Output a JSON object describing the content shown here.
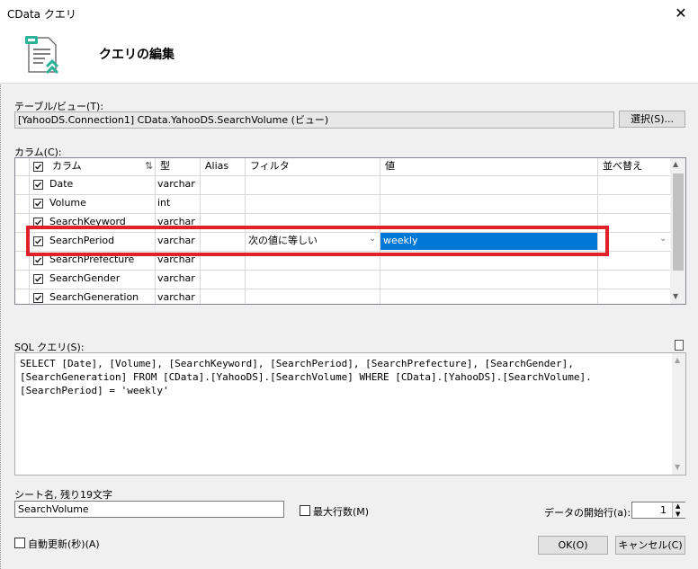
{
  "window": {
    "title": "CData クエリ",
    "close_glyph": "✕"
  },
  "header": {
    "title": "クエリの編集",
    "icon": "query-document-icon"
  },
  "table_view": {
    "label": "テーブル/ビュー(T):",
    "value": "[YahooDS.Connection1] CData.YahooDS.SearchVolume (ビュー)",
    "select_button": "選択(S)..."
  },
  "columns": {
    "label": "カラム(C):",
    "headers": {
      "column": "カラム",
      "type": "型",
      "alias": "Alias",
      "filter": "フィルタ",
      "value": "値",
      "sort": "並べ替え"
    },
    "rows": [
      {
        "checked": true,
        "name": "Date",
        "type": "varchar",
        "alias": "",
        "filter": "",
        "value": ""
      },
      {
        "checked": true,
        "name": "Volume",
        "type": "int",
        "alias": "",
        "filter": "",
        "value": ""
      },
      {
        "checked": true,
        "name": "SearchKeyword",
        "type": "varchar",
        "alias": "",
        "filter": "",
        "value": ""
      },
      {
        "checked": true,
        "name": "SearchPeriod",
        "type": "varchar",
        "alias": "",
        "filter": "次の値に等しい",
        "value": "weekly"
      },
      {
        "checked": true,
        "name": "SearchPrefecture",
        "type": "varchar",
        "alias": "",
        "filter": "",
        "value": ""
      },
      {
        "checked": true,
        "name": "SearchGender",
        "type": "varchar",
        "alias": "",
        "filter": "",
        "value": ""
      },
      {
        "checked": true,
        "name": "SearchGeneration",
        "type": "varchar",
        "alias": "",
        "filter": "",
        "value": ""
      }
    ]
  },
  "sql": {
    "label": "SQL クエリ(S):",
    "text": "SELECT [Date], [Volume], [SearchKeyword], [SearchPeriod], [SearchPrefecture], [SearchGender],\n[SearchGeneration] FROM [CData].[YahooDS].[SearchVolume] WHERE [CData].[YahooDS].[SearchVolume].\n[SearchPeriod] = 'weekly'"
  },
  "sheet": {
    "label": "シート名, 残り19文字",
    "value": "SearchVolume"
  },
  "max_rows": {
    "label": "最大行数(M)",
    "checked": false
  },
  "start_row": {
    "label": "データの開始行(a):",
    "value": "1"
  },
  "auto_refresh": {
    "label": "自動更新(秒)(A)",
    "checked": false
  },
  "buttons": {
    "ok": "OK(O)",
    "cancel": "キャンセル(C)"
  },
  "colors": {
    "selection": "#0078d7",
    "highlight_border": "#e0202a",
    "accent_icon": "#2bb39a"
  }
}
